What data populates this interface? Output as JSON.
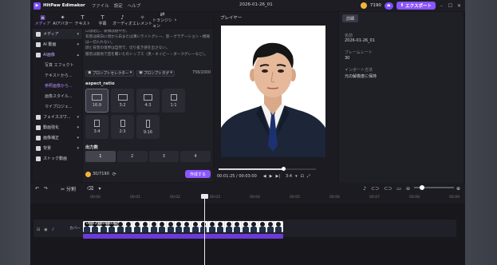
{
  "app": {
    "name": "HitPaw Edimakor",
    "menu": [
      "ファイル",
      "設定",
      "ヘルプ"
    ],
    "doc_title": "2026-01-26_01",
    "credits": "7190",
    "upgrade": "⏏",
    "export_label": "エクスポート",
    "accent": "#8b55ff"
  },
  "tool_tabs": [
    {
      "icon": "▣",
      "label": "メディア",
      "active": true
    },
    {
      "icon": "✦",
      "label": "AIアバター"
    },
    {
      "icon": "T",
      "label": "テキスト"
    },
    {
      "icon": "T",
      "label": "字幕"
    },
    {
      "icon": "♪",
      "label": "オーディオ"
    },
    {
      "icon": "✧",
      "label": "エレメント"
    },
    {
      "icon": "⇄",
      "label": "トランジション"
    }
  ],
  "sidebar": [
    {
      "label": "メディア",
      "expanded": true
    },
    {
      "label": "AI 動画"
    },
    {
      "label": "AI画像",
      "selected": true
    },
    {
      "label": "写真 エフェクト",
      "sub": true
    },
    {
      "label": "テキストから...",
      "sub": true
    },
    {
      "label": "参照画像から...",
      "sub": true,
      "highlight": true
    },
    {
      "label": "画像スタイル...",
      "sub": true
    },
    {
      "label": "マイプロジェ...",
      "sub": true
    },
    {
      "label": "フェイススワ..."
    },
    {
      "label": "動画強化"
    },
    {
      "label": "画像補正"
    },
    {
      "label": "背景"
    },
    {
      "label": "ストック動画"
    }
  ],
  "prompt": {
    "lines": [
      "ロは閉じ、表情は穏やか。",
      "背景は純白に母から白または薄いライトグレー、影・グラデーション・模様は一切入れない。",
      "顔と背景の境界は自然で、切り抜き感を出さない。",
      "服装は無地で首を覆いたのトップス（黒・ネイビー・ダークグレーなど）。"
    ],
    "btn_selector": "プロンプトセレクター",
    "btn_tag": "プロンプトタグ",
    "count": "758/2000"
  },
  "aspect": {
    "title": "aspect_ratio",
    "options": [
      "16:9",
      "3:2",
      "4:3",
      "1:1",
      "3:4",
      "2:3",
      "9:16"
    ],
    "selected": "16:9"
  },
  "output": {
    "title": "出力数",
    "options": [
      "1",
      "2",
      "3",
      "4"
    ],
    "selected": "1"
  },
  "generate": {
    "credits": "30/7190",
    "button": "作成する"
  },
  "player": {
    "title": "プレイヤー",
    "time": "00:01:25 / 00:03:00",
    "ratio": "3:4"
  },
  "details": {
    "tab": "詳細",
    "items": [
      {
        "key": "名前",
        "value": "2026-01-26_01"
      },
      {
        "key": "フレームレート",
        "value": "30"
      },
      {
        "key": "インポート方法",
        "value": "元の解像度に保持"
      }
    ]
  },
  "timeline": {
    "toolbar": [
      "↶",
      "↷",
      "✂ 分割",
      "⌫",
      "▾"
    ],
    "ruler": [
      "00:00",
      "00:01",
      "00:02",
      "00:03",
      "00:04",
      "00:05",
      "00:06",
      "00:07",
      "00:08",
      "00:09"
    ],
    "clip_label": "00:03 00000000",
    "track_label": "カバー",
    "thumb_count": 24
  }
}
